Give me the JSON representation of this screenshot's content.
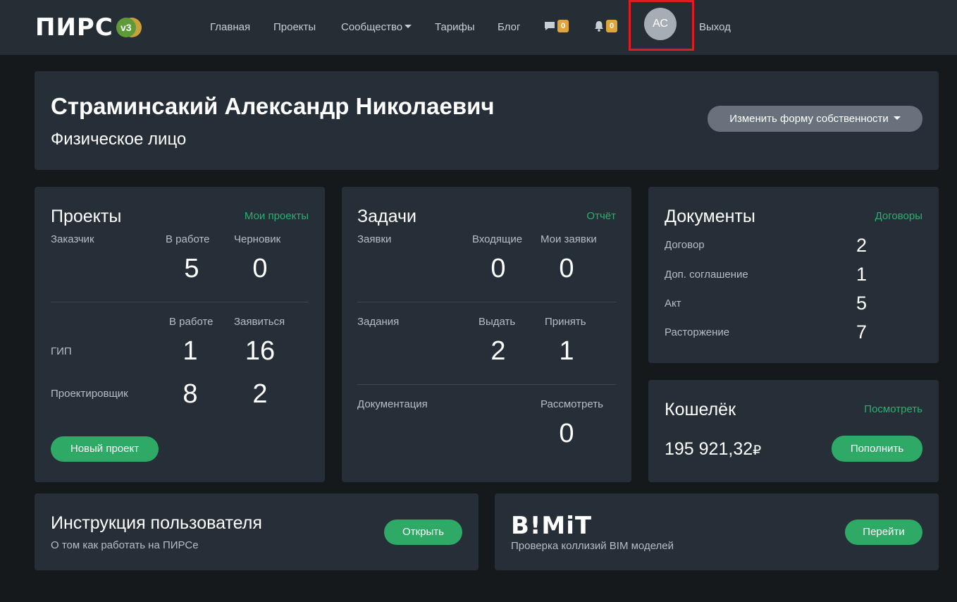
{
  "header": {
    "logo_text": "ПИРС",
    "logo_version": "v3",
    "nav": {
      "home": "Главная",
      "projects": "Проекты",
      "community": "Сообщество",
      "tariffs": "Тарифы",
      "blog": "Блог",
      "logout": "Выход"
    },
    "messages_count": "0",
    "notifications_count": "0",
    "avatar_initials": "АС",
    "colors": {
      "badge": "#e0a43a",
      "highlight": "#e11b22"
    }
  },
  "profile": {
    "name": "Страминсакий Александр Николаевич",
    "type": "Физическое лицо",
    "change_button": "Изменить форму собственности"
  },
  "projects_card": {
    "title": "Проекты",
    "link": "Мои проекты",
    "customer_label": "Заказчик",
    "col_in_work": "В работе",
    "col_draft": "Черновик",
    "customer_in_work": "5",
    "customer_draft": "0",
    "col2_in_work": "В работе",
    "col2_apply": "Заявиться",
    "gip_label": "ГИП",
    "gip_in_work": "1",
    "gip_apply": "16",
    "designer_label": "Проектировщик",
    "designer_in_work": "8",
    "designer_apply": "2",
    "new_project_button": "Новый проект"
  },
  "tasks_card": {
    "title": "Задачи",
    "link": "Отчёт",
    "requests_label": "Заявки",
    "col_incoming": "Входящие",
    "col_my_requests": "Мои заявки",
    "incoming": "0",
    "my_requests": "0",
    "assignments_label": "Задания",
    "col_issue": "Выдать",
    "col_accept": "Принять",
    "issue": "2",
    "accept": "1",
    "documentation_label": "Документация",
    "col_review": "Рассмотреть",
    "review": "0"
  },
  "documents_card": {
    "title": "Документы",
    "link": "Договоры",
    "rows": [
      {
        "label": "Договор",
        "value": "2"
      },
      {
        "label": "Доп. соглашение",
        "value": "1"
      },
      {
        "label": "Акт",
        "value": "5"
      },
      {
        "label": "Расторжение",
        "value": "7"
      }
    ]
  },
  "wallet_card": {
    "title": "Кошелёк",
    "link": "Посмотреть",
    "balance": "195 921,32",
    "currency": "₽",
    "top_up_button": "Пополнить"
  },
  "instruction_card": {
    "title": "Инструкция пользователя",
    "subtitle": "О том как работать на ПИРСе",
    "button": "Открыть"
  },
  "bimit_card": {
    "logo_text": "B!MiT",
    "subtitle": "Проверка коллизий BIM моделей",
    "button": "Перейти"
  }
}
